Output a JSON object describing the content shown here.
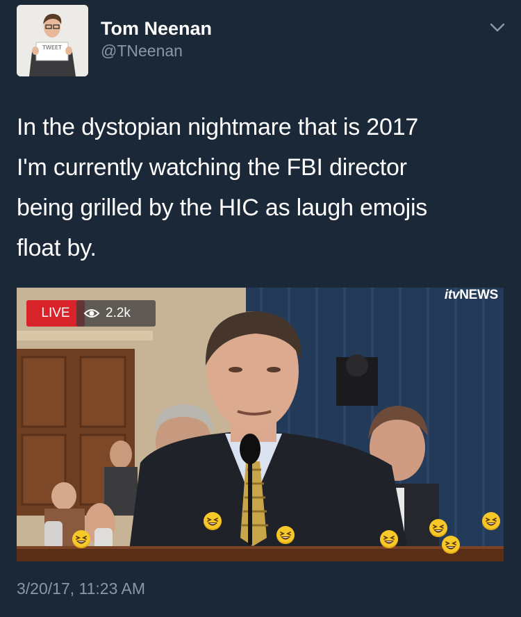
{
  "author": {
    "display_name": "Tom Neenan",
    "handle": "@TNeenan",
    "avatar_sign_text": "TWEET"
  },
  "tweet": {
    "text": "In the dystopian nightmare that is 2017\nI'm currently watching the FBI director\nbeing grilled by the HIC as laugh emojis\nfloat by.",
    "timestamp": "3/20/17, 11:23 AM"
  },
  "media": {
    "live_label": "LIVE",
    "viewer_count": "2.2k",
    "broadcaster_prefix": "itv",
    "broadcaster_suffix": "NEWS",
    "emoji_icon": "laughing-face-icon"
  },
  "colors": {
    "background": "#1b2837",
    "secondary_text": "#8899a6",
    "live_red": "#d9232a"
  }
}
